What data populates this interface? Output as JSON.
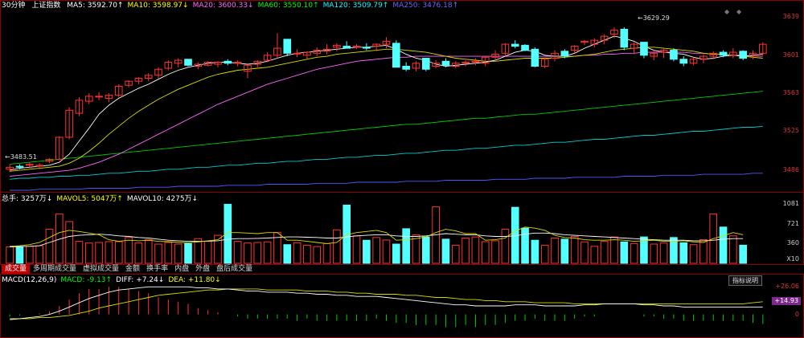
{
  "header": {
    "period": "30分钟",
    "index_name": "上证指数",
    "ma": [
      {
        "label": "MA5: 3592.70↑",
        "color": "#ffffff"
      },
      {
        "label": "MA10: 3598.97↓",
        "color": "#ffff00"
      },
      {
        "label": "MA20: 3600.33↓",
        "color": "#ff66ff"
      },
      {
        "label": "MA60: 3550.10↑",
        "color": "#00ff00"
      },
      {
        "label": "MA120: 3509.79↑",
        "color": "#00ffff"
      },
      {
        "label": "MA250: 3476.18↑",
        "color": "#6666ff"
      }
    ]
  },
  "price_axis": {
    "ticks": [
      "3639",
      "3601",
      "3563",
      "3525",
      "3486"
    ]
  },
  "annotations": {
    "high": "3629.29",
    "low": "3483.51"
  },
  "volume_bar": {
    "items": [
      {
        "label": "总手: 3257万↓",
        "color": "#ffffff"
      },
      {
        "label": "MAVOL5: 5047万↑",
        "color": "#ffff00"
      },
      {
        "label": "MAVOL10: 4275万↓",
        "color": "#ffffff"
      }
    ],
    "axis": [
      "1081",
      "721",
      "360",
      "X10"
    ]
  },
  "tabs": [
    "成交量",
    "多周期成交量",
    "虚拟成交量",
    "金额",
    "换手率",
    "内盘",
    "外盘",
    "盘后成交量"
  ],
  "macd_bar": {
    "items": [
      {
        "label": "MACD(12,26,9)",
        "color": "#ffffff"
      },
      {
        "label": "MACD: -9.13↑",
        "color": "#00ff00"
      },
      {
        "label": "DIFF: +7.24↓",
        "color": "#ffffff"
      },
      {
        "label": "DEA: +11.80↓",
        "color": "#ffff00"
      }
    ],
    "axis": [
      "+26.06",
      "0"
    ],
    "tag": "+14.93",
    "button": "指标说明"
  },
  "colors": {
    "up": "#ff3232",
    "down": "#54ffff",
    "frame": "#8b0000"
  },
  "chart_data": {
    "type": "candlestick",
    "ylim": [
      3470,
      3645
    ],
    "candles": [
      [
        3487,
        3492,
        3484,
        3489
      ],
      [
        3490,
        3492,
        3487,
        3489
      ],
      [
        3491,
        3494,
        3488,
        3492
      ],
      [
        3490,
        3493,
        3487,
        3491
      ],
      [
        3495,
        3498,
        3493,
        3497
      ],
      [
        3497,
        3520,
        3496,
        3519
      ],
      [
        3519,
        3549,
        3517,
        3546
      ],
      [
        3543,
        3559,
        3540,
        3556
      ],
      [
        3555,
        3563,
        3552,
        3560
      ],
      [
        3560,
        3564,
        3556,
        3560
      ],
      [
        3558,
        3563,
        3554,
        3561
      ],
      [
        3561,
        3572,
        3559,
        3570
      ],
      [
        3571,
        3576,
        3569,
        3575
      ],
      [
        3575,
        3579,
        3572,
        3578
      ],
      [
        3578,
        3583,
        3575,
        3581
      ],
      [
        3581,
        3589,
        3578,
        3587
      ],
      [
        3588,
        3596,
        3586,
        3594
      ],
      [
        3593,
        3598,
        3589,
        3596
      ],
      [
        3597,
        3597,
        3590,
        3591
      ],
      [
        3590,
        3594,
        3587,
        3592
      ],
      [
        3591,
        3595,
        3590,
        3594
      ],
      [
        3592,
        3595,
        3589,
        3594
      ],
      [
        3595,
        3597,
        3591,
        3593
      ],
      [
        3593,
        3596,
        3590,
        3594
      ],
      [
        3585,
        3593,
        3578,
        3591
      ],
      [
        3592,
        3596,
        3589,
        3595
      ],
      [
        3596,
        3604,
        3594,
        3601
      ],
      [
        3601,
        3623,
        3598,
        3608
      ],
      [
        3617,
        3617,
        3600,
        3603
      ],
      [
        3603,
        3607,
        3599,
        3603
      ],
      [
        3601,
        3605,
        3597,
        3604
      ],
      [
        3603,
        3609,
        3600,
        3606
      ],
      [
        3605,
        3612,
        3602,
        3607
      ],
      [
        3609,
        3613,
        3605,
        3611
      ],
      [
        3610,
        3615,
        3608,
        3608
      ],
      [
        3610,
        3612,
        3607,
        3610
      ],
      [
        3609,
        3613,
        3606,
        3608
      ],
      [
        3610,
        3613,
        3605,
        3612
      ],
      [
        3612,
        3619,
        3608,
        3615
      ],
      [
        3613,
        3616,
        3593,
        3589
      ],
      [
        3590,
        3594,
        3585,
        3587
      ],
      [
        3588,
        3595,
        3585,
        3593
      ],
      [
        3598,
        3598,
        3585,
        3587
      ],
      [
        3590,
        3596,
        3588,
        3593
      ],
      [
        3595,
        3598,
        3589,
        3591
      ],
      [
        3590,
        3595,
        3588,
        3593
      ],
      [
        3593,
        3596,
        3590,
        3594
      ],
      [
        3594,
        3598,
        3591,
        3595
      ],
      [
        3593,
        3600,
        3590,
        3599
      ],
      [
        3599,
        3606,
        3596,
        3602
      ],
      [
        3603,
        3613,
        3600,
        3612
      ],
      [
        3612,
        3616,
        3608,
        3610
      ],
      [
        3611,
        3612,
        3605,
        3606
      ],
      [
        3607,
        3609,
        3589,
        3590
      ],
      [
        3590,
        3599,
        3588,
        3597
      ],
      [
        3598,
        3606,
        3595,
        3603
      ],
      [
        3605,
        3607,
        3598,
        3600
      ],
      [
        3606,
        3611,
        3603,
        3610
      ],
      [
        3614,
        3616,
        3611,
        3615
      ],
      [
        3612,
        3618,
        3609,
        3616
      ],
      [
        3616,
        3622,
        3612,
        3620
      ],
      [
        3622,
        3629,
        3618,
        3626
      ],
      [
        3627,
        3629,
        3606,
        3609
      ],
      [
        3608,
        3614,
        3602,
        3612
      ],
      [
        3614,
        3614,
        3598,
        3601
      ],
      [
        3600,
        3606,
        3596,
        3603
      ],
      [
        3604,
        3608,
        3598,
        3606
      ],
      [
        3606,
        3608,
        3595,
        3597
      ],
      [
        3597,
        3600,
        3590,
        3593
      ],
      [
        3593,
        3599,
        3591,
        3597
      ],
      [
        3597,
        3602,
        3593,
        3600
      ],
      [
        3600,
        3605,
        3597,
        3603
      ],
      [
        3604,
        3606,
        3599,
        3601
      ],
      [
        3601,
        3608,
        3598,
        3604
      ],
      [
        3605,
        3606,
        3596,
        3598
      ],
      [
        3600,
        3606,
        3597,
        3603
      ],
      [
        3603,
        3614,
        3601,
        3612
      ]
    ],
    "ma5": [
      3486,
      3488,
      3489,
      3490,
      3491,
      3494,
      3502,
      3515,
      3528,
      3542,
      3551,
      3558,
      3563,
      3568,
      3572,
      3577,
      3582,
      3586,
      3589,
      3591,
      3593,
      3594,
      3594,
      3593,
      3592,
      3593,
      3595,
      3598,
      3601,
      3603,
      3604,
      3605,
      3606,
      3607,
      3608,
      3609,
      3609,
      3610,
      3611,
      3607,
      3602,
      3598,
      3596,
      3592,
      3590,
      3591,
      3592,
      3593,
      3594,
      3596,
      3600,
      3604,
      3606,
      3605,
      3601,
      3600,
      3600,
      3603,
      3608,
      3612,
      3616,
      3620,
      3618,
      3615,
      3610,
      3606,
      3604,
      3603,
      3602,
      3599,
      3597,
      3598,
      3600,
      3601,
      3600,
      3601,
      3602
    ],
    "ma10": [
      3485,
      3486,
      3487,
      3488,
      3489,
      3490,
      3493,
      3498,
      3505,
      3513,
      3522,
      3530,
      3538,
      3545,
      3551,
      3557,
      3562,
      3567,
      3571,
      3575,
      3579,
      3582,
      3584,
      3586,
      3587,
      3588,
      3589,
      3591,
      3593,
      3595,
      3597,
      3599,
      3600,
      3602,
      3603,
      3604,
      3605,
      3606,
      3607,
      3607,
      3606,
      3605,
      3604,
      3602,
      3600,
      3598,
      3597,
      3596,
      3595,
      3595,
      3596,
      3597,
      3598,
      3598,
      3598,
      3598,
      3599,
      3600,
      3601,
      3602,
      3604,
      3606,
      3607,
      3608,
      3609,
      3609,
      3608,
      3607,
      3606,
      3605,
      3603,
      3602,
      3602,
      3601,
      3600,
      3599,
      3598
    ],
    "ma20": [
      3480,
      3481,
      3482,
      3483,
      3484,
      3485,
      3486,
      3488,
      3491,
      3494,
      3498,
      3502,
      3507,
      3512,
      3517,
      3522,
      3527,
      3532,
      3537,
      3542,
      3547,
      3552,
      3556,
      3560,
      3564,
      3568,
      3572,
      3575,
      3578,
      3581,
      3584,
      3587,
      3589,
      3591,
      3593,
      3595,
      3596,
      3597,
      3598,
      3599,
      3599,
      3600,
      3600,
      3600,
      3600,
      3600,
      3600,
      3600,
      3600,
      3600,
      3600,
      3600,
      3600,
      3600,
      3600,
      3600,
      3600,
      3600,
      3601,
      3601,
      3602,
      3602,
      3603,
      3603,
      3604,
      3604,
      3604,
      3604,
      3604,
      3603,
      3603,
      3602,
      3602,
      3601,
      3601,
      3600,
      3600
    ],
    "ma60": [
      3492,
      3493,
      3494,
      3495,
      3496,
      3497,
      3498,
      3499,
      3500,
      3501,
      3502,
      3503,
      3504,
      3505,
      3506,
      3507,
      3508,
      3509,
      3510,
      3511,
      3512,
      3513,
      3514,
      3515,
      3516,
      3517,
      3518,
      3519,
      3520,
      3521,
      3522,
      3523,
      3524,
      3525,
      3526,
      3527,
      3528,
      3529,
      3530,
      3531,
      3532,
      3532,
      3533,
      3534,
      3535,
      3536,
      3537,
      3538,
      3538,
      3539,
      3540,
      3541,
      3542,
      3542,
      3543,
      3544,
      3545,
      3546,
      3547,
      3548,
      3549,
      3550,
      3551,
      3552,
      3553,
      3554,
      3555,
      3556,
      3557,
      3558,
      3559,
      3560,
      3561,
      3562,
      3563,
      3564,
      3565
    ],
    "ma120": [
      3477,
      3478,
      3478,
      3479,
      3479,
      3480,
      3480,
      3481,
      3481,
      3482,
      3483,
      3483,
      3484,
      3485,
      3485,
      3486,
      3487,
      3487,
      3488,
      3489,
      3489,
      3490,
      3491,
      3491,
      3492,
      3493,
      3493,
      3494,
      3495,
      3495,
      3496,
      3497,
      3497,
      3498,
      3499,
      3499,
      3500,
      3501,
      3501,
      3502,
      3503,
      3503,
      3504,
      3505,
      3506,
      3506,
      3507,
      3508,
      3508,
      3509,
      3510,
      3511,
      3511,
      3512,
      3513,
      3514,
      3514,
      3515,
      3516,
      3517,
      3517,
      3518,
      3519,
      3520,
      3521,
      3521,
      3522,
      3523,
      3524,
      3525,
      3525,
      3526,
      3527,
      3528,
      3529,
      3529,
      3530
    ],
    "ma250": [
      3466,
      3466,
      3466,
      3467,
      3467,
      3467,
      3467,
      3467,
      3468,
      3468,
      3468,
      3468,
      3468,
      3469,
      3469,
      3469,
      3469,
      3470,
      3470,
      3470,
      3470,
      3470,
      3471,
      3471,
      3471,
      3471,
      3472,
      3472,
      3472,
      3472,
      3472,
      3473,
      3473,
      3473,
      3473,
      3474,
      3474,
      3474,
      3474,
      3474,
      3475,
      3475,
      3475,
      3475,
      3476,
      3476,
      3476,
      3476,
      3476,
      3477,
      3477,
      3477,
      3477,
      3478,
      3478,
      3478,
      3478,
      3479,
      3479,
      3479,
      3479,
      3479,
      3480,
      3480,
      3480,
      3480,
      3481,
      3481,
      3481,
      3481,
      3482,
      3482,
      3482,
      3482,
      3482,
      3483,
      3483
    ],
    "volume": {
      "ylim": [
        0,
        1081
      ],
      "values": [
        300,
        305,
        310,
        320,
        620,
        900,
        760,
        400,
        370,
        380,
        395,
        395,
        470,
        370,
        430,
        350,
        380,
        350,
        360,
        450,
        400,
        510,
        1075,
        400,
        370,
        380,
        390,
        560,
        340,
        375,
        330,
        305,
        360,
        610,
        1060,
        500,
        420,
        470,
        425,
        350,
        630,
        520,
        480,
        1028,
        440,
        330,
        460,
        480,
        395,
        410,
        620,
        1020,
        640,
        420,
        330,
        460,
        440,
        490,
        390,
        310,
        400,
        480,
        390,
        360,
        480,
        350,
        370,
        470,
        375,
        340,
        430,
        900,
        660,
        500,
        330
      ],
      "mavol5": [
        310,
        320,
        340,
        380,
        470,
        560,
        600,
        580,
        550,
        520,
        430,
        400,
        420,
        410,
        420,
        400,
        395,
        380,
        375,
        390,
        410,
        430,
        560,
        560,
        550,
        540,
        560,
        560,
        420,
        420,
        400,
        380,
        360,
        380,
        520,
        560,
        580,
        600,
        560,
        420,
        430,
        450,
        480,
        560,
        620,
        590,
        540,
        540,
        420,
        430,
        460,
        590,
        660,
        640,
        600,
        510,
        470,
        460,
        430,
        420,
        420,
        430,
        420,
        400,
        410,
        420,
        400,
        400,
        410,
        390,
        380,
        450,
        500,
        560,
        520
      ],
      "mavol10": [
        300,
        305,
        310,
        320,
        380,
        440,
        490,
        510,
        520,
        530,
        520,
        500,
        490,
        470,
        460,
        440,
        420,
        410,
        400,
        400,
        405,
        410,
        440,
        450,
        450,
        455,
        460,
        470,
        480,
        480,
        475,
        470,
        460,
        460,
        480,
        500,
        510,
        520,
        520,
        500,
        490,
        490,
        500,
        520,
        540,
        530,
        520,
        520,
        500,
        490,
        490,
        500,
        530,
        550,
        550,
        540,
        520,
        510,
        500,
        490,
        480,
        470,
        460,
        450,
        440,
        430,
        420,
        420,
        420,
        410,
        410,
        420,
        440,
        450,
        450
      ]
    },
    "macd": {
      "ylim": [
        -20,
        30
      ],
      "diff": [
        -5,
        -4,
        -3,
        -2,
        0,
        3,
        7,
        11,
        15,
        18,
        21,
        23,
        24,
        25,
        26,
        26,
        26,
        26,
        26,
        25,
        25,
        24,
        24,
        23,
        22,
        22,
        21,
        21,
        21,
        20,
        20,
        19,
        19,
        18,
        18,
        17,
        17,
        17,
        16,
        15,
        14,
        13,
        12,
        11,
        10,
        9,
        9,
        8,
        8,
        8,
        8,
        9,
        9,
        9,
        8,
        8,
        8,
        8,
        9,
        9,
        10,
        10,
        10,
        10,
        9,
        9,
        8,
        8,
        7,
        7,
        7,
        7,
        7,
        7,
        7,
        7,
        7
      ],
      "dea": [
        -4,
        -4,
        -4,
        -3,
        -3,
        -2,
        -1,
        1,
        3,
        6,
        8,
        10,
        12,
        14,
        16,
        18,
        19,
        20,
        21,
        22,
        23,
        23,
        24,
        24,
        24,
        24,
        23,
        23,
        23,
        23,
        22,
        22,
        22,
        21,
        21,
        20,
        20,
        19,
        19,
        19,
        18,
        18,
        17,
        16,
        16,
        15,
        14,
        14,
        13,
        13,
        12,
        12,
        12,
        11,
        11,
        11,
        11,
        10,
        10,
        10,
        10,
        10,
        10,
        10,
        10,
        10,
        10,
        10,
        10,
        10,
        10,
        10,
        10,
        10,
        10,
        11,
        12
      ],
      "hist": [
        -2,
        -1,
        0,
        1,
        3,
        8,
        14,
        20,
        24,
        24,
        26,
        26,
        24,
        22,
        20,
        16,
        14,
        12,
        10,
        6,
        4,
        2,
        0,
        -2,
        -4,
        -4,
        -4,
        -4,
        -4,
        -6,
        -4,
        -6,
        -6,
        -6,
        -6,
        -6,
        -6,
        -4,
        -6,
        -8,
        -8,
        -10,
        -10,
        -10,
        -12,
        -12,
        -10,
        -12,
        -10,
        -10,
        -8,
        -6,
        -6,
        -4,
        -6,
        -6,
        -6,
        -4,
        -2,
        -2,
        0,
        0,
        0,
        0,
        -2,
        -2,
        -4,
        -4,
        -6,
        -6,
        -6,
        -6,
        -6,
        -6,
        -6,
        -8,
        -9
      ]
    }
  }
}
